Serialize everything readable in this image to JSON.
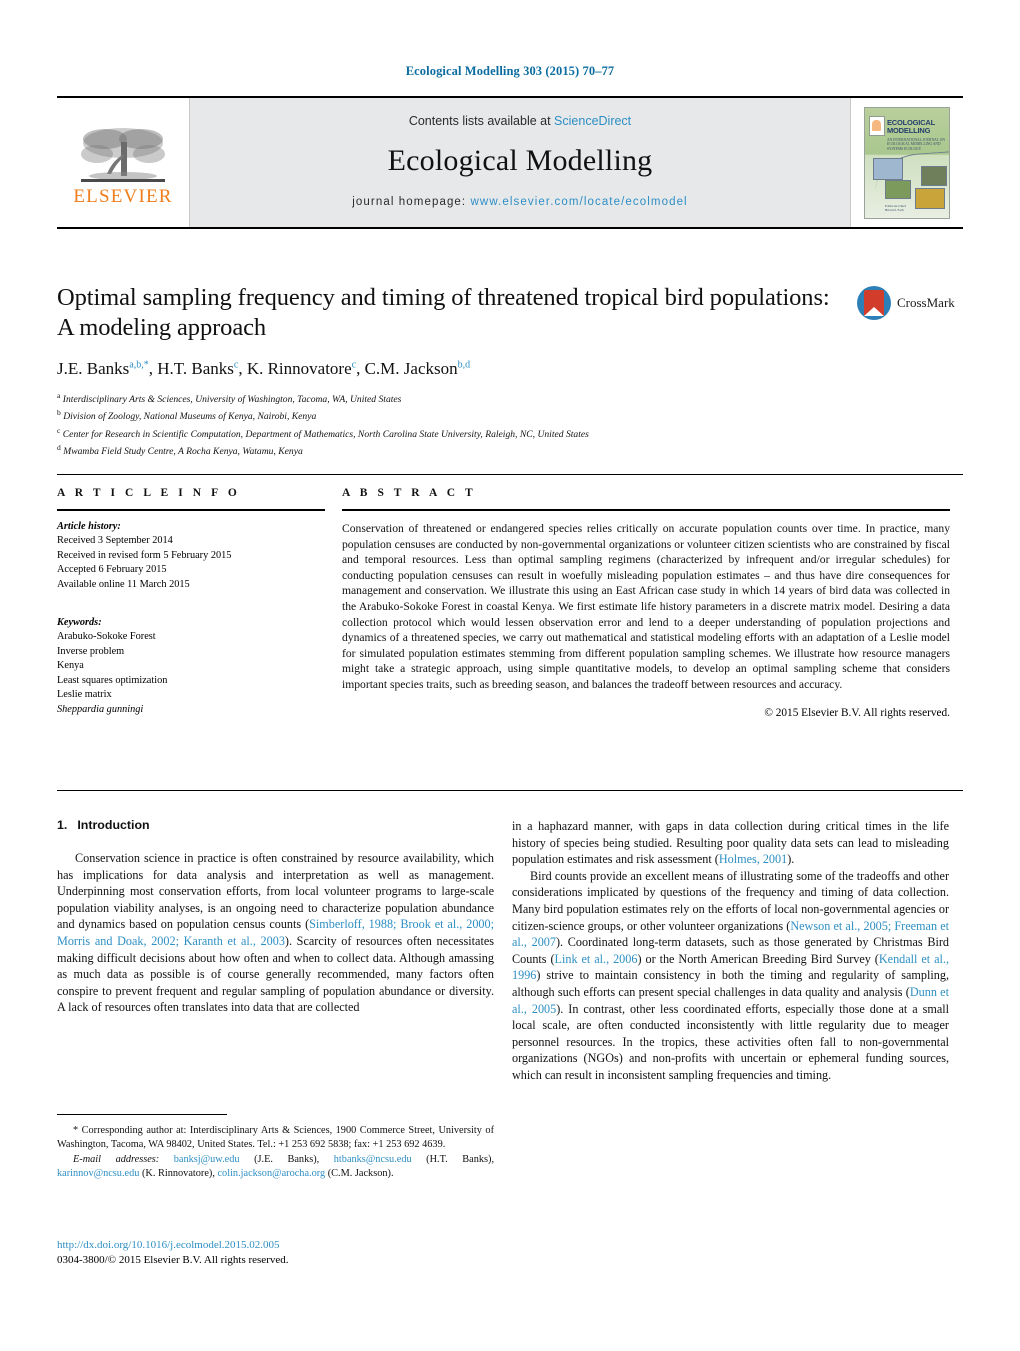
{
  "running_head": "Ecological Modelling 303 (2015) 70–77",
  "masthead": {
    "elsevier_wordmark": "ELSEVIER",
    "contents_prefix": "Contents lists available at ",
    "contents_link": "ScienceDirect",
    "journal_name": "Ecological Modelling",
    "homepage_prefix": "journal homepage: ",
    "homepage_url": "www.elsevier.com/locate/ecolmodel",
    "cover": {
      "title_line1": "ECOLOGICAL",
      "title_line2": "MODELLING",
      "subtitle": "AN INTERNATIONAL JOURNAL ON ECOLOGICAL MODELLING AND SYSTEMS ECOLOGY",
      "editor_label": "Editor-in-Chief",
      "editor_name": "Brian D. Fath"
    }
  },
  "article": {
    "title": "Optimal sampling frequency and timing of threatened tropical bird populations: A modeling approach",
    "authors": [
      {
        "name": "J.E. Banks",
        "marks": "a,b,*"
      },
      {
        "name": "H.T. Banks",
        "marks": "c"
      },
      {
        "name": "K. Rinnovatore",
        "marks": "c"
      },
      {
        "name": "C.M. Jackson",
        "marks": "b,d"
      }
    ],
    "affiliations": [
      {
        "mark": "a",
        "text": "Interdisciplinary Arts & Sciences, University of Washington, Tacoma, WA, United States"
      },
      {
        "mark": "b",
        "text": "Division of Zoology, National Museums of Kenya, Nairobi, Kenya"
      },
      {
        "mark": "c",
        "text": "Center for Research in Scientific Computation, Department of Mathematics, North Carolina State University, Raleigh, NC, United States"
      },
      {
        "mark": "d",
        "text": "Mwamba Field Study Centre, A Rocha Kenya, Watamu, Kenya"
      }
    ]
  },
  "crossmark": {
    "label": "CrossMark"
  },
  "article_info": {
    "heading": "A R T I C L E   I N F O",
    "history_label": "Article history:",
    "history": [
      "Received 3 September 2014",
      "Received in revised form 5 February 2015",
      "Accepted 6 February 2015",
      "Available online 11 March 2015"
    ],
    "keywords_label": "Keywords:",
    "keywords": [
      "Arabuko-Sokoke Forest",
      "Inverse problem",
      "Kenya",
      "Least squares optimization",
      "Leslie matrix"
    ],
    "keyword_italic": "Sheppardia gunningi"
  },
  "abstract": {
    "heading": "A B S T R A C T",
    "body": "Conservation of threatened or endangered species relies critically on accurate population counts over time. In practice, many population censuses are conducted by non-governmental organizations or volunteer citizen scientists who are constrained by fiscal and temporal resources. Less than optimal sampling regimens (characterized by infrequent and/or irregular schedules) for conducting population censuses can result in woefully misleading population estimates – and thus have dire consequences for management and conservation. We illustrate this using an East African case study in which 14 years of bird data was collected in the Arabuko-Sokoke Forest in coastal Kenya. We first estimate life history parameters in a discrete matrix model. Desiring a data collection protocol which would lessen observation error and lend to a deeper understanding of population projections and dynamics of a threatened species, we carry out mathematical and statistical modeling efforts with an adaptation of a Leslie model for simulated population estimates stemming from different population sampling schemes. We illustrate how resource managers might take a strategic approach, using simple quantitative models, to develop an optimal sampling scheme that considers important species traits, such as breeding season, and balances the tradeoff between resources and accuracy.",
    "copyright": "© 2015 Elsevier B.V. All rights reserved."
  },
  "introduction": {
    "number": "1.",
    "heading": "Introduction",
    "left_paragraph_1_a": "Conservation science in practice is often constrained by resource availability, which has implications for data analysis and interpretation as well as management. Underpinning most conservation efforts, from local volunteer programs to large-scale population viability analyses, is an ongoing need to characterize population abundance and dynamics based on population census counts (",
    "left_ref_1": "Simberloff, 1988; Brook et al., 2000; Morris and Doak, 2002; Karanth et al., 2003",
    "left_paragraph_1_b": "). Scarcity of resources often necessitates making difficult decisions about how often and when to collect data. Although amassing as much data as possible is of course generally recommended, many factors often conspire to prevent frequent and regular sampling of population abundance or diversity. A lack of resources often translates into data that are collected",
    "right_paragraph_1_a": "in a haphazard manner, with gaps in data collection during critical times in the life history of species being studied. Resulting poor quality data sets can lead to misleading population estimates and risk assessment (",
    "right_ref_1": "Holmes, 2001",
    "right_paragraph_1_b": ").",
    "right_paragraph_2_a": "Bird counts provide an excellent means of illustrating some of the tradeoffs and other considerations implicated by questions of the frequency and timing of data collection. Many bird population estimates rely on the efforts of local non-governmental agencies or citizen-science groups, or other volunteer organizations (",
    "right_ref_2": "Newson et al., 2005; Freeman et al., 2007",
    "right_paragraph_2_b": "). Coordinated long-term datasets, such as those generated by Christmas Bird Counts (",
    "right_ref_3": "Link et al., 2006",
    "right_paragraph_2_c": ") or the North American Breeding Bird Survey (",
    "right_ref_4": "Kendall et al., 1996",
    "right_paragraph_2_d": ") strive to maintain consistency in both the timing and regularity of sampling, although such efforts can present special challenges in data quality and analysis (",
    "right_ref_5": "Dunn et al., 2005",
    "right_paragraph_2_e": "). In contrast, other less coordinated efforts, especially those done at a small local scale, are often conducted inconsistently with little regularity due to meager personnel resources. In the tropics, these activities often fall to non-governmental organizations (NGOs) and non-profits with uncertain or ephemeral funding sources, which can result in inconsistent sampling frequencies and timing."
  },
  "footnotes": {
    "corresponding": "* Corresponding author at: Interdisciplinary Arts & Sciences, 1900 Commerce Street, University of Washington, Tacoma, WA 98402, United States. Tel.: +1 253 692 5838; fax: +1 253 692 4639.",
    "email_label": "E-mail addresses:",
    "emails": [
      {
        "address": "banksj@uw.edu",
        "owner": "(J.E. Banks)"
      },
      {
        "address": "htbanks@ncsu.edu",
        "owner": "(H.T. Banks)"
      },
      {
        "address": "karinnov@ncsu.edu",
        "owner": "(K. Rinnovatore)"
      },
      {
        "address": "colin.jackson@arocha.org",
        "owner": "(C.M. Jackson)"
      }
    ]
  },
  "doi": {
    "url": "http://dx.doi.org/10.1016/j.ecolmodel.2015.02.005",
    "issn_line": "0304-3800/© 2015 Elsevier B.V. All rights reserved."
  },
  "colors": {
    "link_blue": "#2e8fc4",
    "running_head_blue": "#0b6ca0",
    "elsevier_orange": "#ef7d1a",
    "band_gray": "#e7e8ea"
  }
}
